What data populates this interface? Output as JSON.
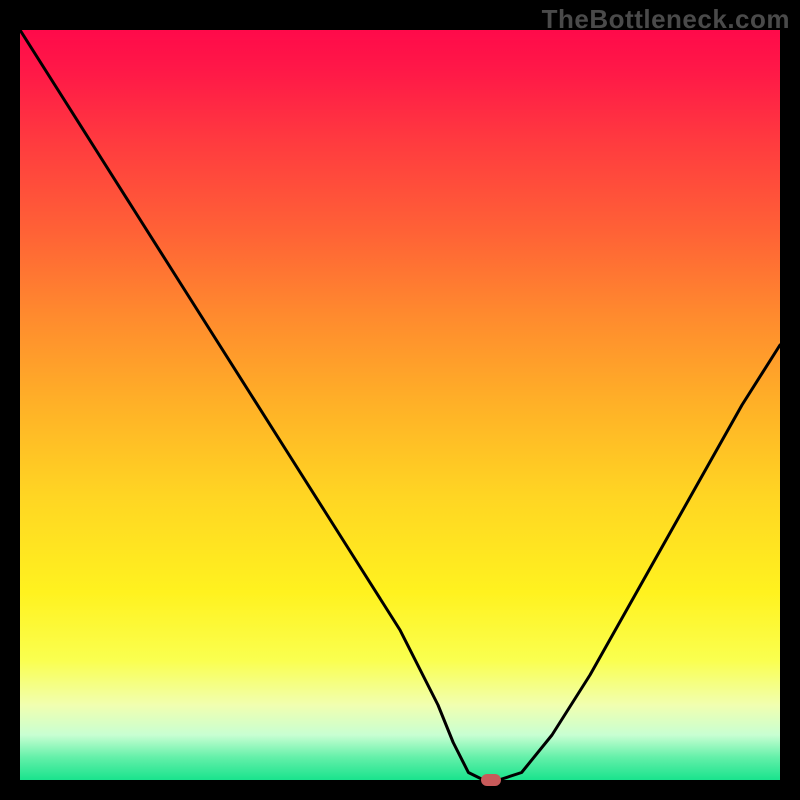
{
  "watermark": "TheBottleneck.com",
  "chart_data": {
    "type": "line",
    "title": "",
    "xlabel": "",
    "ylabel": "",
    "xlim": [
      0,
      100
    ],
    "ylim": [
      0,
      100
    ],
    "grid": false,
    "legend": false,
    "series": [
      {
        "name": "bottleneck-curve",
        "x": [
          0,
          5,
          10,
          15,
          20,
          25,
          30,
          35,
          40,
          45,
          50,
          55,
          57,
          59,
          61,
          63,
          66,
          70,
          75,
          80,
          85,
          90,
          95,
          100
        ],
        "y": [
          100,
          92,
          84,
          76,
          68,
          60,
          52,
          44,
          36,
          28,
          20,
          10,
          5,
          1,
          0,
          0,
          1,
          6,
          14,
          23,
          32,
          41,
          50,
          58
        ]
      }
    ],
    "marker": {
      "x": 62,
      "y": 0,
      "color": "#c85a5a"
    },
    "background_gradient": [
      "#ff0a4a",
      "#ff6236",
      "#ffd523",
      "#faff4f",
      "#19e38d"
    ]
  }
}
